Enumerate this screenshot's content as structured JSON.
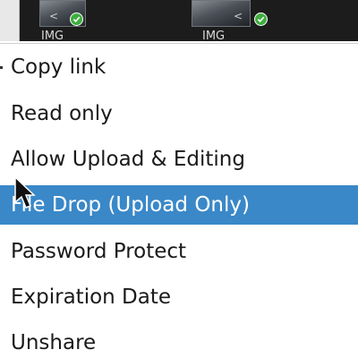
{
  "background_files": [
    {
      "name": "IMG",
      "icon": "share-icon",
      "status_icon": "check-icon"
    },
    {
      "name": "IMG",
      "icon": "share-icon",
      "status_icon": "check-icon"
    }
  ],
  "menu": {
    "items": [
      {
        "label": "Copy link",
        "highlighted": false
      },
      {
        "label": "Read only",
        "highlighted": false
      },
      {
        "label": "Allow Upload & Editing",
        "highlighted": false
      },
      {
        "label": "File Drop (Upload Only)",
        "highlighted": true
      },
      {
        "label": "Password Protect",
        "highlighted": false
      },
      {
        "label": "Expiration Date",
        "highlighted": false
      },
      {
        "label": "Unshare",
        "highlighted": false
      }
    ]
  },
  "colors": {
    "highlight": "#3a88c8",
    "status_ok": "#3fae3f",
    "backdrop": "#1c1c1c"
  }
}
